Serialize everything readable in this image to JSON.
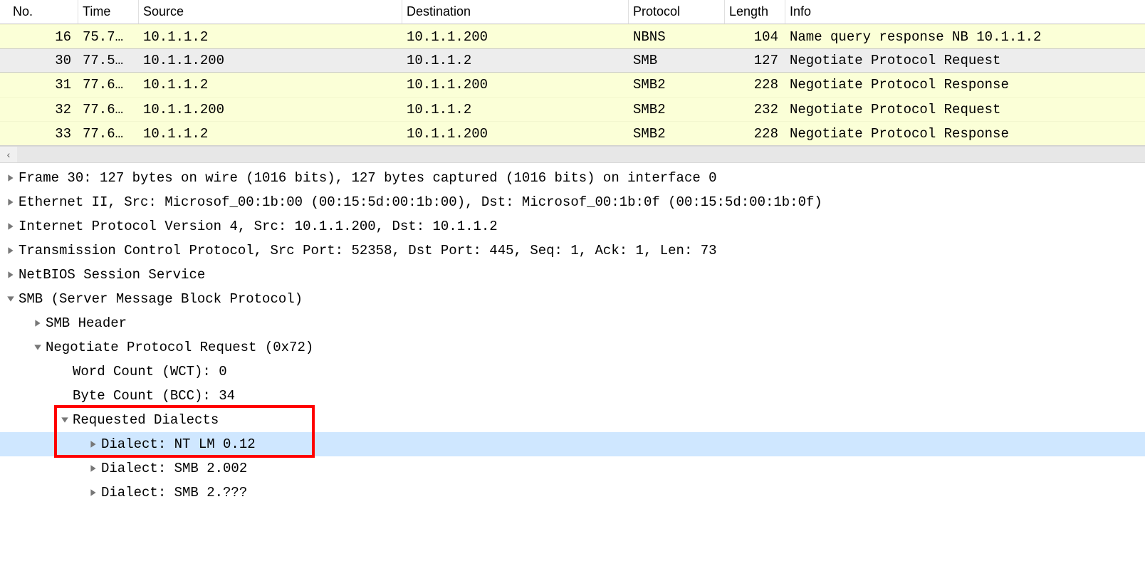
{
  "columns": {
    "no": "No.",
    "time": "Time",
    "source": "Source",
    "destination": "Destination",
    "protocol": "Protocol",
    "length": "Length",
    "info": "Info"
  },
  "packets": [
    {
      "no": "16",
      "time": "75.7…",
      "source": "10.1.1.2",
      "destination": "10.1.1.200",
      "protocol": "NBNS",
      "length": "104",
      "info": "Name query response NB 10.1.1.2",
      "selected": false
    },
    {
      "no": "30",
      "time": "77.5…",
      "source": "10.1.1.200",
      "destination": "10.1.1.2",
      "protocol": "SMB",
      "length": "127",
      "info": "Negotiate Protocol Request",
      "selected": true
    },
    {
      "no": "31",
      "time": "77.6…",
      "source": "10.1.1.2",
      "destination": "10.1.1.200",
      "protocol": "SMB2",
      "length": "228",
      "info": "Negotiate Protocol Response",
      "selected": false
    },
    {
      "no": "32",
      "time": "77.6…",
      "source": "10.1.1.200",
      "destination": "10.1.1.2",
      "protocol": "SMB2",
      "length": "232",
      "info": "Negotiate Protocol Request",
      "selected": false
    },
    {
      "no": "33",
      "time": "77.6…",
      "source": "10.1.1.2",
      "destination": "10.1.1.200",
      "protocol": "SMB2",
      "length": "228",
      "info": "Negotiate Protocol Response",
      "selected": false
    }
  ],
  "tree": [
    {
      "indent": 0,
      "caret": "right",
      "label": "Frame 30: 127 bytes on wire (1016 bits), 127 bytes captured (1016 bits) on interface 0",
      "selected": false,
      "boxed": false
    },
    {
      "indent": 0,
      "caret": "right",
      "label": "Ethernet II, Src: Microsof_00:1b:00 (00:15:5d:00:1b:00), Dst: Microsof_00:1b:0f (00:15:5d:00:1b:0f)",
      "selected": false,
      "boxed": false
    },
    {
      "indent": 0,
      "caret": "right",
      "label": "Internet Protocol Version 4, Src: 10.1.1.200, Dst: 10.1.1.2",
      "selected": false,
      "boxed": false
    },
    {
      "indent": 0,
      "caret": "right",
      "label": "Transmission Control Protocol, Src Port: 52358, Dst Port: 445, Seq: 1, Ack: 1, Len: 73",
      "selected": false,
      "boxed": false
    },
    {
      "indent": 0,
      "caret": "right",
      "label": "NetBIOS Session Service",
      "selected": false,
      "boxed": false
    },
    {
      "indent": 0,
      "caret": "down",
      "label": "SMB (Server Message Block Protocol)",
      "selected": false,
      "boxed": false
    },
    {
      "indent": 1,
      "caret": "right",
      "label": "SMB Header",
      "selected": false,
      "boxed": false
    },
    {
      "indent": 1,
      "caret": "down",
      "label": "Negotiate Protocol Request (0x72)",
      "selected": false,
      "boxed": false
    },
    {
      "indent": 2,
      "caret": "none",
      "label": "Word Count (WCT): 0",
      "selected": false,
      "boxed": false
    },
    {
      "indent": 2,
      "caret": "none",
      "label": "Byte Count (BCC): 34",
      "selected": false,
      "boxed": false
    },
    {
      "indent": 2,
      "caret": "down",
      "label": "Requested Dialects",
      "selected": false,
      "boxed": true
    },
    {
      "indent": 3,
      "caret": "right",
      "label": "Dialect: NT LM 0.12",
      "selected": true,
      "boxed": true
    },
    {
      "indent": 3,
      "caret": "right",
      "label": "Dialect: SMB 2.002",
      "selected": false,
      "boxed": false
    },
    {
      "indent": 3,
      "caret": "right",
      "label": "Dialect: SMB 2.???",
      "selected": false,
      "boxed": false
    }
  ],
  "scroll_left_glyph": "‹"
}
